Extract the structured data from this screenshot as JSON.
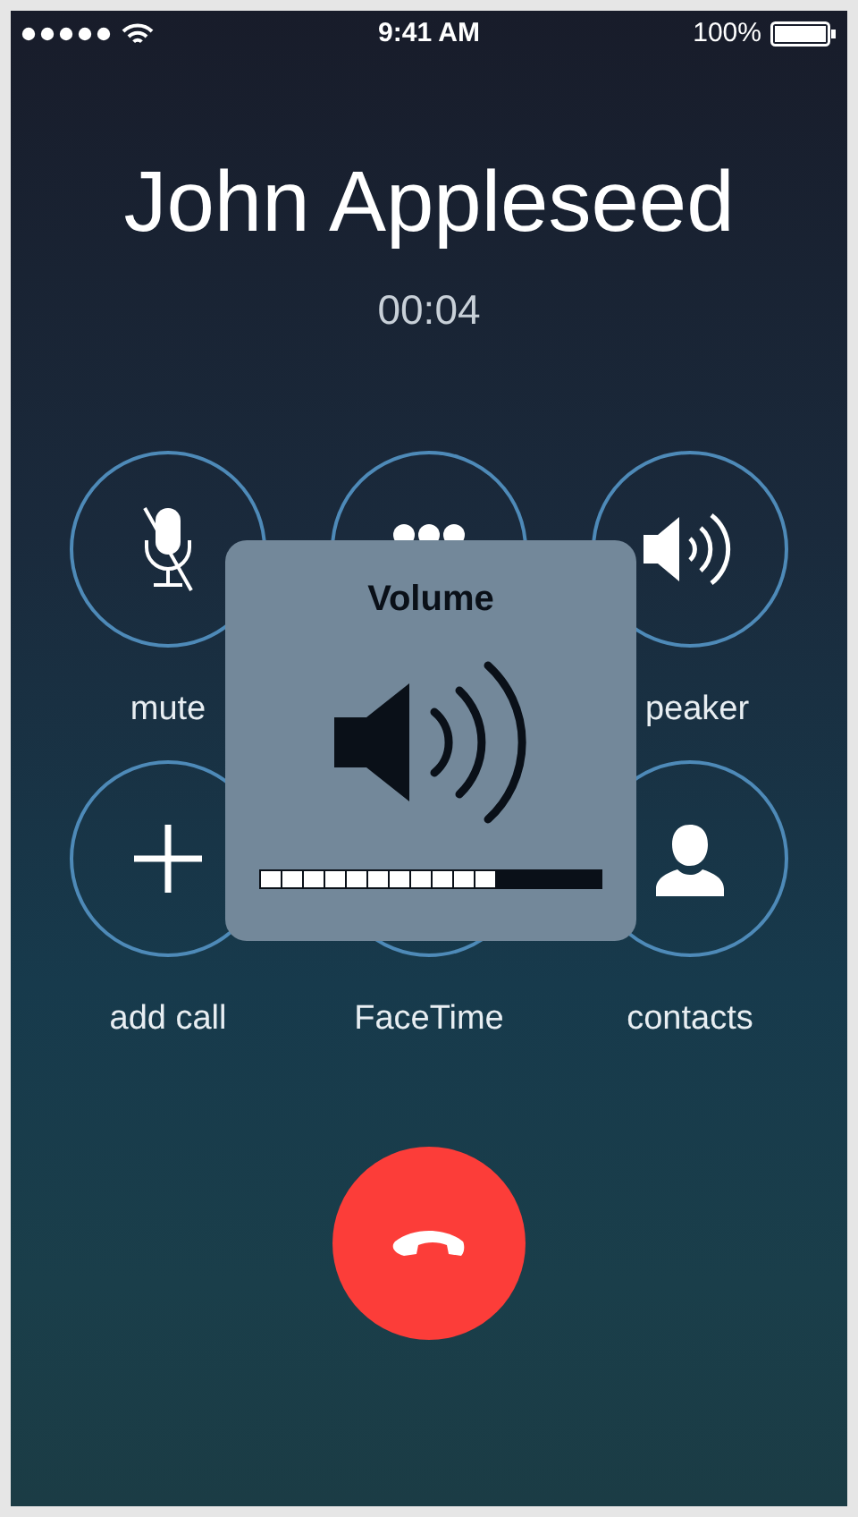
{
  "status_bar": {
    "time": "9:41 AM",
    "battery": "100%"
  },
  "caller": {
    "name": "John Appleseed",
    "duration": "00:04"
  },
  "buttons": [
    {
      "kind": "mute",
      "label": "mute"
    },
    {
      "kind": "keypad"
    },
    {
      "kind": "speaker",
      "label": "peaker"
    },
    {
      "kind": "add",
      "label": "add call"
    },
    {
      "kind": "facetime",
      "label": "FaceTime"
    },
    {
      "kind": "contacts",
      "label": "contacts"
    }
  ],
  "volume_hud": {
    "title": "Volume",
    "level": 0.6875
  },
  "end_call": {
    "kind": "hangup"
  }
}
